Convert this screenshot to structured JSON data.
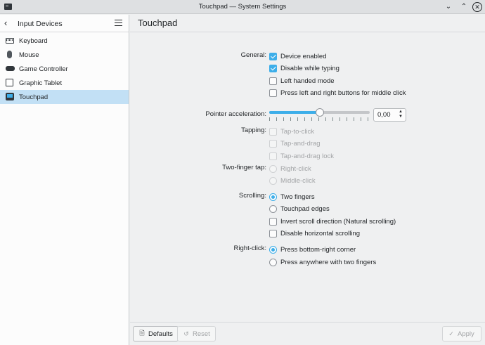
{
  "window": {
    "title": "Touchpad — System Settings"
  },
  "sidebar": {
    "title": "Input Devices",
    "items": [
      {
        "label": "Keyboard",
        "icon": "keyboard-icon"
      },
      {
        "label": "Mouse",
        "icon": "mouse-icon"
      },
      {
        "label": "Game Controller",
        "icon": "gamepad-icon"
      },
      {
        "label": "Graphic Tablet",
        "icon": "tablet-icon"
      },
      {
        "label": "Touchpad",
        "icon": "touchpad-icon",
        "selected": true
      }
    ]
  },
  "main": {
    "title": "Touchpad",
    "general": {
      "label": "General:",
      "options": [
        {
          "label": "Device enabled",
          "checked": true
        },
        {
          "label": "Disable while typing",
          "checked": true
        },
        {
          "label": "Left handed mode",
          "checked": false
        },
        {
          "label": "Press left and right buttons for middle click",
          "checked": false
        }
      ]
    },
    "pointer": {
      "label": "Pointer acceleration:",
      "value": "0,00",
      "slider_fraction": 0.5
    },
    "tapping": {
      "label": "Tapping:",
      "options": [
        {
          "label": "Tap-to-click",
          "checked": false,
          "disabled": true
        },
        {
          "label": "Tap-and-drag",
          "checked": false,
          "disabled": true
        },
        {
          "label": "Tap-and-drag lock",
          "checked": false,
          "disabled": true
        }
      ]
    },
    "two_finger_tap": {
      "label": "Two-finger tap:",
      "options": [
        {
          "label": "Right-click",
          "disabled": true
        },
        {
          "label": "Middle-click",
          "disabled": true
        }
      ]
    },
    "scrolling": {
      "label": "Scrolling:",
      "radios": [
        {
          "label": "Two fingers",
          "checked": true
        },
        {
          "label": "Touchpad edges",
          "checked": false
        }
      ],
      "checks": [
        {
          "label": "Invert scroll direction (Natural scrolling)",
          "checked": false
        },
        {
          "label": "Disable horizontal scrolling",
          "checked": false
        }
      ]
    },
    "right_click": {
      "label": "Right-click:",
      "options": [
        {
          "label": "Press bottom-right corner",
          "checked": true
        },
        {
          "label": "Press anywhere with two fingers",
          "checked": false
        }
      ]
    }
  },
  "footer": {
    "defaults": "Defaults",
    "reset": "Reset",
    "apply": "Apply"
  },
  "colors": {
    "accent": "#3daee9",
    "selection": "#c2e0f5"
  }
}
